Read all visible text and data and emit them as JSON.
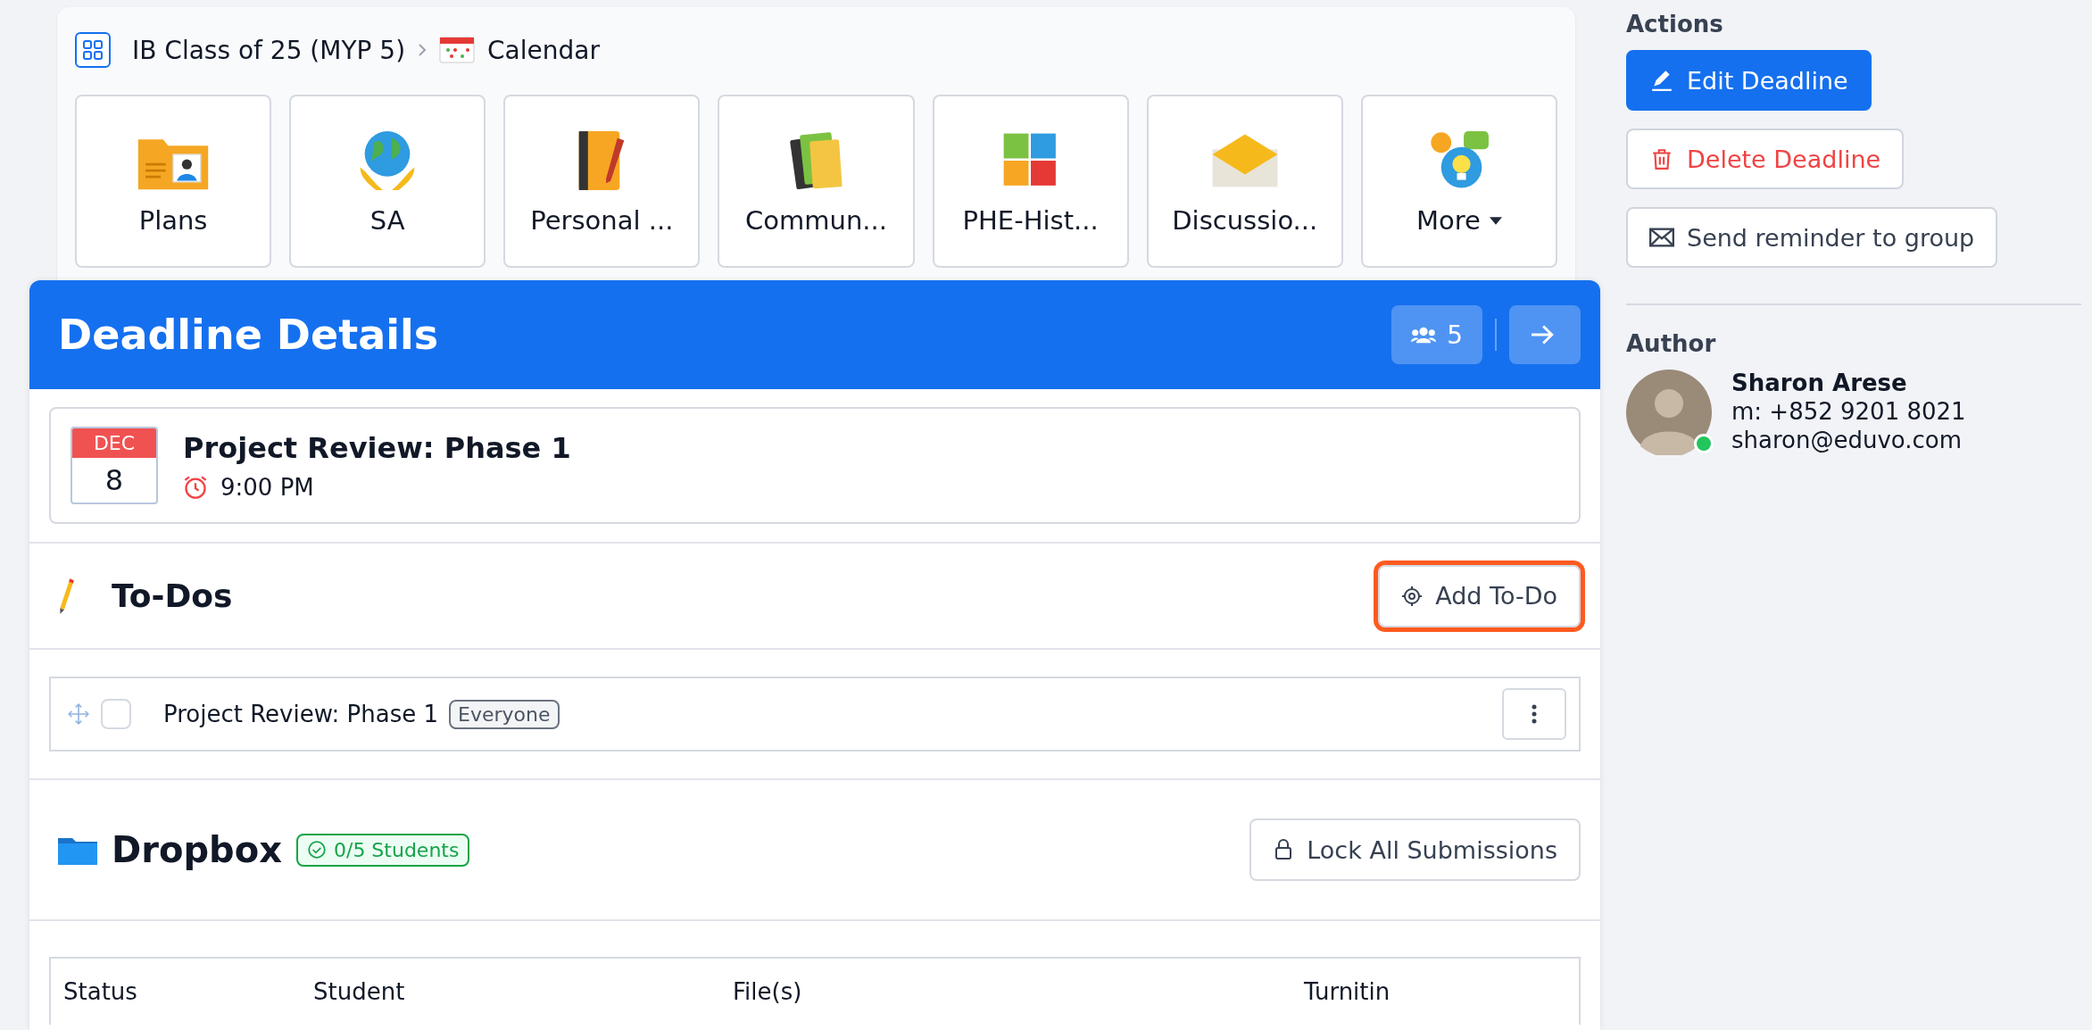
{
  "breadcrumb": {
    "class_name": "IB Class of 25 (MYP 5)",
    "page": "Calendar"
  },
  "apps": [
    {
      "label": "Plans",
      "dropdown": false
    },
    {
      "label": "SA",
      "dropdown": false
    },
    {
      "label": "Personal ...",
      "dropdown": false
    },
    {
      "label": "Commun...",
      "dropdown": false
    },
    {
      "label": "PHE-Hist...",
      "dropdown": false
    },
    {
      "label": "Discussio...",
      "dropdown": false
    },
    {
      "label": "More",
      "dropdown": true
    }
  ],
  "panel": {
    "title": "Deadline Details",
    "members_count": "5"
  },
  "event": {
    "month": "DEC",
    "day": "8",
    "title": "Project Review: Phase 1",
    "time": "9:00 PM"
  },
  "todos": {
    "title": "To-Dos",
    "add_button": {
      "label": "Add To-Do",
      "highlighted": true
    },
    "items": [
      {
        "text": "Project Review: Phase 1",
        "tag": "Everyone",
        "checked": false
      }
    ]
  },
  "dropbox": {
    "title": "Dropbox",
    "badge": "0/5 Students",
    "lock_button": "Lock All Submissions",
    "table": {
      "columns": [
        "Status",
        "Student",
        "File(s)",
        "Turnitin"
      ]
    }
  },
  "actions": {
    "title": "Actions",
    "buttons": [
      {
        "label": "Edit Deadline",
        "kind": "primary"
      },
      {
        "label": "Delete Deadline",
        "kind": "danger"
      },
      {
        "label": "Send reminder to group",
        "kind": "mail"
      }
    ]
  },
  "author": {
    "title": "Author",
    "name": "Sharon Arese",
    "phone": "m: +852 9201 8021",
    "email": "sharon@eduvo.com",
    "online": true
  }
}
